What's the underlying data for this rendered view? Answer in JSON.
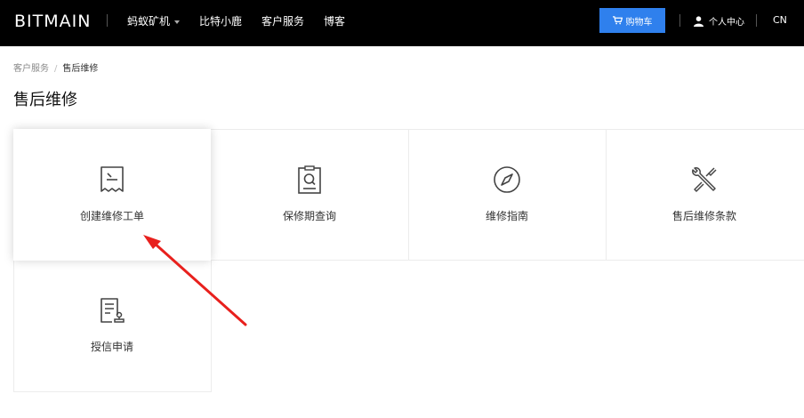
{
  "nav": {
    "logo": "BITMAIN",
    "items": [
      {
        "label": "蚂蚁矿机",
        "has_dropdown": true
      },
      {
        "label": "比特小鹿",
        "has_dropdown": false
      },
      {
        "label": "客户服务",
        "has_dropdown": false
      },
      {
        "label": "博客",
        "has_dropdown": false
      }
    ],
    "cart_label": "购物车",
    "user_label": "个人中心",
    "lang_label": "CN"
  },
  "breadcrumb": {
    "items": [
      "客户服务",
      "售后维修"
    ],
    "separator": "/"
  },
  "page_title": "售后维修",
  "cards": [
    {
      "label": "创建维修工单",
      "icon": "receipt-icon",
      "highlighted": true
    },
    {
      "label": "保修期查询",
      "icon": "clipboard-search-icon",
      "highlighted": false
    },
    {
      "label": "维修指南",
      "icon": "compass-icon",
      "highlighted": false
    },
    {
      "label": "售后维修条款",
      "icon": "tools-icon",
      "highlighted": false
    },
    {
      "label": "授信申请",
      "icon": "credit-application-icon",
      "highlighted": false
    }
  ],
  "colors": {
    "nav_bg": "#000000",
    "cart_button": "#2f80ed",
    "annotation_arrow": "#e8201d"
  }
}
